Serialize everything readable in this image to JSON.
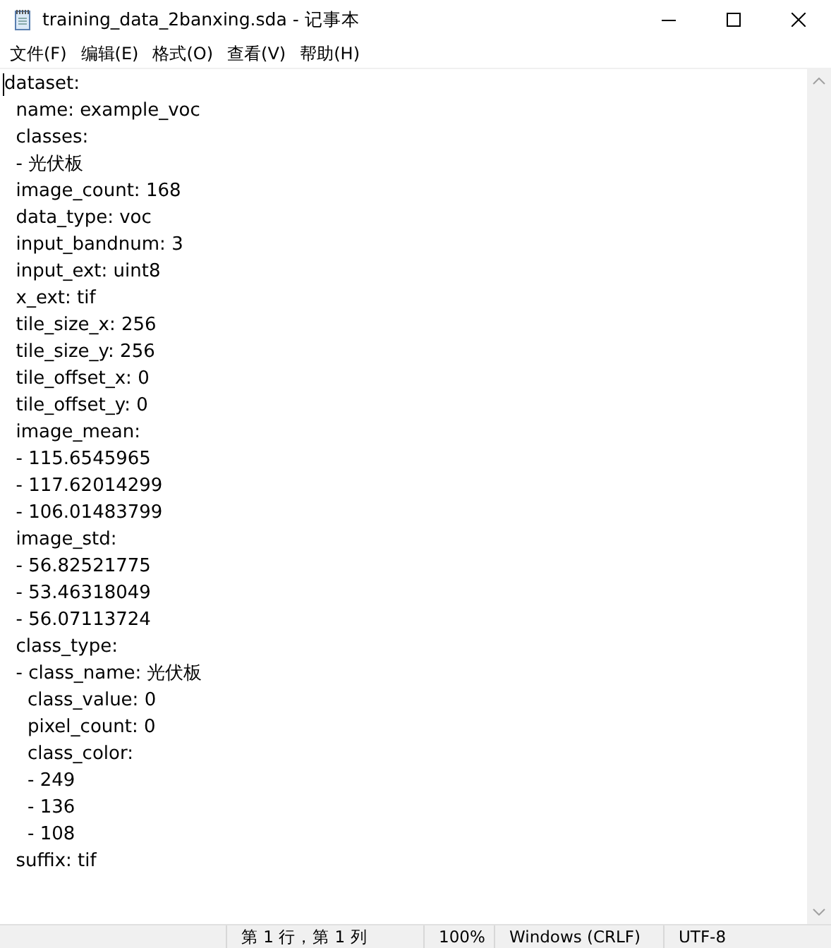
{
  "window": {
    "title": "training_data_2banxing.sda - 记事本"
  },
  "menu": [
    {
      "label": "文件(F)"
    },
    {
      "label": "编辑(E)"
    },
    {
      "label": "格式(O)"
    },
    {
      "label": "查看(V)"
    },
    {
      "label": "帮助(H)"
    }
  ],
  "editor": {
    "lines": [
      "dataset:",
      "  name: example_voc",
      "  classes:",
      "  - 光伏板",
      "  image_count: 168",
      "  data_type: voc",
      "  input_bandnum: 3",
      "  input_ext: uint8",
      "  x_ext: tif",
      "  tile_size_x: 256",
      "  tile_size_y: 256",
      "  tile_offset_x: 0",
      "  tile_offset_y: 0",
      "  image_mean:",
      "  - 115.6545965",
      "  - 117.62014299",
      "  - 106.01483799",
      "  image_std:",
      "  - 56.82521775",
      "  - 53.46318049",
      "  - 56.07113724",
      "  class_type:",
      "  - class_name: 光伏板",
      "    class_value: 0",
      "    pixel_count: 0",
      "    class_color:",
      "    - 249",
      "    - 136",
      "    - 108",
      "  suffix: tif"
    ]
  },
  "status_bar": {
    "position": "第 1 行，第 1 列",
    "zoom": "100%",
    "line_ending": "Windows (CRLF)",
    "encoding": "UTF-8"
  }
}
